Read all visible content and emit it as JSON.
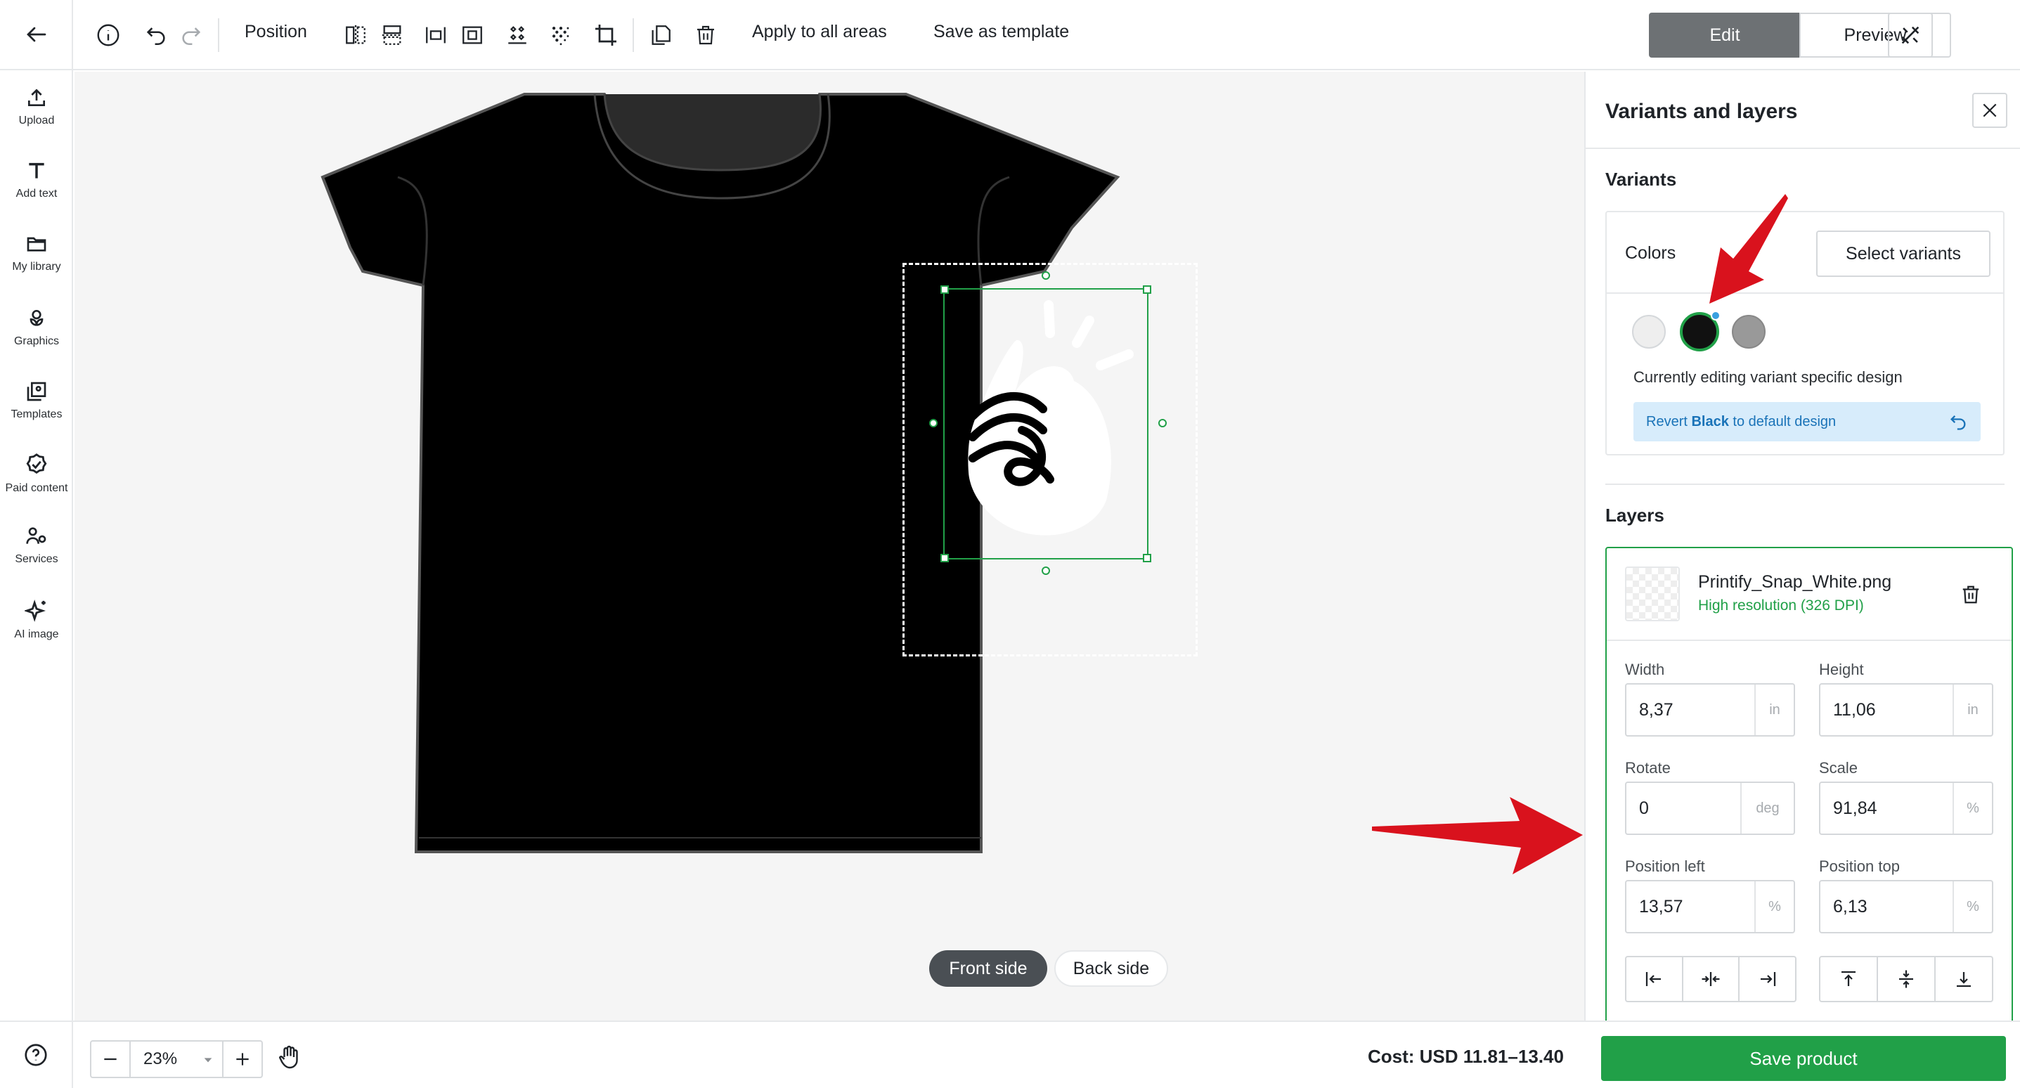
{
  "sidebar": {
    "items": [
      {
        "label": "Upload",
        "icon": "upload-icon"
      },
      {
        "label": "Add text",
        "icon": "text-icon"
      },
      {
        "label": "My library",
        "icon": "folder-icon"
      },
      {
        "label": "Graphics",
        "icon": "graphics-icon"
      },
      {
        "label": "Templates",
        "icon": "templates-icon"
      },
      {
        "label": "Paid content",
        "icon": "badge-check-icon"
      },
      {
        "label": "Services",
        "icon": "services-icon"
      },
      {
        "label": "AI image",
        "icon": "sparkles-icon"
      }
    ]
  },
  "toolbar": {
    "position_label": "Position",
    "apply_label": "Apply to all areas",
    "template_label": "Save as template",
    "edit_label": "Edit",
    "preview_label": "Preview"
  },
  "canvas": {
    "front_label": "Front side",
    "back_label": "Back side",
    "shirt_color": "#000000"
  },
  "panel": {
    "title": "Variants and layers",
    "variants_title": "Variants",
    "colors_label": "Colors",
    "select_variants_label": "Select variants",
    "swatches": [
      {
        "name": "White",
        "color": "#eeeeee",
        "selected": false
      },
      {
        "name": "Black",
        "color": "#111111",
        "selected": true
      },
      {
        "name": "Heather",
        "color": "#999999",
        "selected": false
      }
    ],
    "editing_note": "Currently editing variant specific design",
    "revert_prefix": "Revert ",
    "revert_color": "Black",
    "revert_suffix": " to default design",
    "layers_title": "Layers",
    "layer": {
      "filename": "Printify_Snap_White.png",
      "resolution": "High resolution (326 DPI)"
    },
    "fields": {
      "width": {
        "label": "Width",
        "value": "8,37",
        "unit": "in"
      },
      "height": {
        "label": "Height",
        "value": "11,06",
        "unit": "in"
      },
      "rotate": {
        "label": "Rotate",
        "value": "0",
        "unit": "deg"
      },
      "scale": {
        "label": "Scale",
        "value": "91,84",
        "unit": "%"
      },
      "pos_left": {
        "label": "Position left",
        "value": "13,57",
        "unit": "%"
      },
      "pos_top": {
        "label": "Position top",
        "value": "6,13",
        "unit": "%"
      }
    }
  },
  "bottombar": {
    "zoom": "23%",
    "cost": "Cost: USD 11.81–13.40",
    "save_label": "Save product"
  },
  "colors": {
    "accent_green": "#21a048",
    "arrow_red": "#d9121d",
    "revert_bg": "#d7ecfb",
    "revert_text": "#1a73b8"
  }
}
